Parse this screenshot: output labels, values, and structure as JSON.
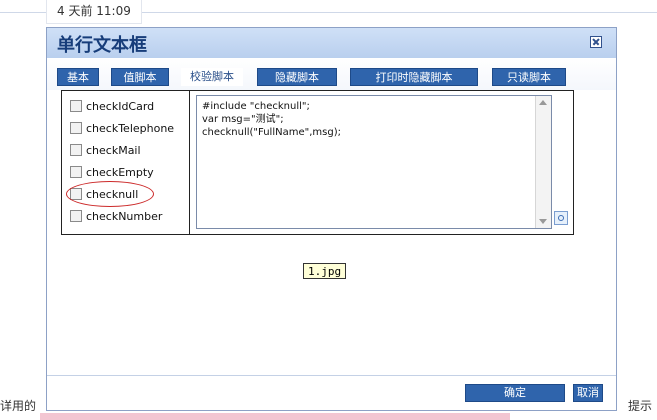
{
  "page": {
    "top_label": "4 天前 11:09",
    "bottom_left": "详用的",
    "bottom_right": "提示"
  },
  "dialog": {
    "title": "单行文本框",
    "tabs": [
      {
        "label": "基本"
      },
      {
        "label": "值脚本"
      },
      {
        "label": "校验脚本"
      },
      {
        "label": "隐藏脚本"
      },
      {
        "label": "打印时隐藏脚本"
      },
      {
        "label": "只读脚本"
      }
    ],
    "checks": [
      {
        "label": "checkIdCard"
      },
      {
        "label": "checkTelephone"
      },
      {
        "label": "checkMail"
      },
      {
        "label": "checkEmpty"
      },
      {
        "label": "checknull"
      },
      {
        "label": "checkNumber"
      }
    ],
    "code": [
      "#include \"checknull\";",
      "var msg=\"测试\";",
      "checknull(\"FullName\",msg);"
    ],
    "tooltip": "1.jpg",
    "confirm": "确定",
    "cancel": "取消"
  },
  "colors": {
    "accent": "#2f64ac",
    "titlebar": "#c4d8f4",
    "highlight": "#cc2a2a"
  }
}
